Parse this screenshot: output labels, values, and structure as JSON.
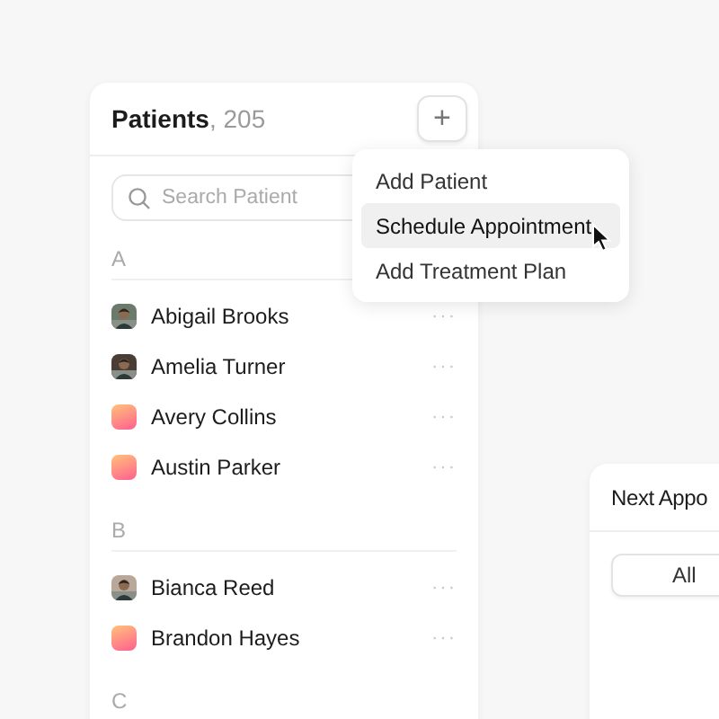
{
  "patients_panel": {
    "title": "Patients",
    "count": ", 205",
    "add_button": "+",
    "search": {
      "placeholder": "Search Patient"
    },
    "groups": [
      {
        "letter": "A",
        "patients": [
          {
            "name": "Abigail Brooks",
            "more": "···"
          },
          {
            "name": "Amelia Turner",
            "more": "···"
          },
          {
            "name": "Avery Collins",
            "avatar": {
              "kind": "placeholder"
            },
            "more": "···"
          },
          {
            "name": "Austin Parker",
            "avatar": {
              "kind": "placeholder"
            },
            "more": "···"
          }
        ]
      },
      {
        "letter": "B",
        "patients": [
          {
            "name": "Bianca Reed",
            "more": "···"
          },
          {
            "name": "Brandon Hayes",
            "avatar": {
              "kind": "placeholder"
            },
            "more": "···"
          }
        ]
      },
      {
        "letter": "C"
      }
    ]
  },
  "add_menu": {
    "items": [
      {
        "label": "Add Patient",
        "selected": false
      },
      {
        "label": "Schedule Appointment",
        "selected": true
      },
      {
        "label": "Add Treatment Plan",
        "selected": false
      }
    ]
  },
  "appointments_panel": {
    "title": "Next Appo",
    "filter_button": "All"
  }
}
